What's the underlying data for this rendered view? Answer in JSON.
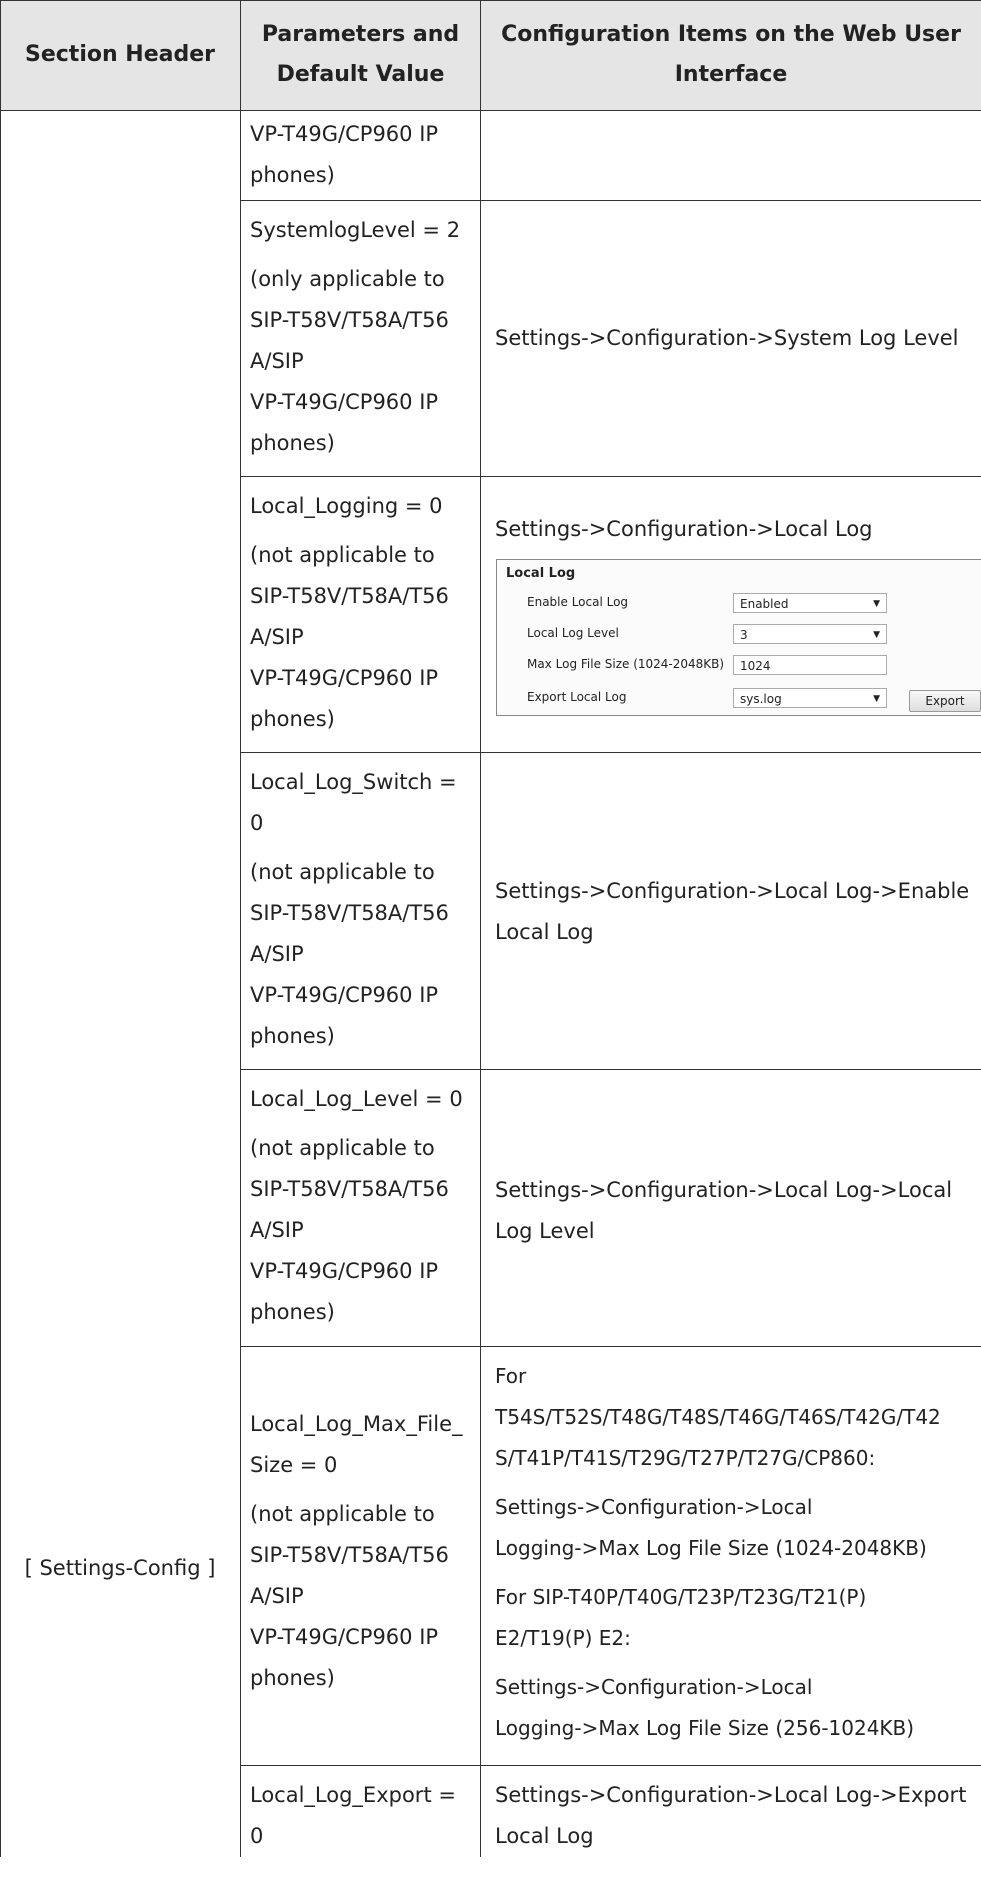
{
  "headers": {
    "section": "Section Header",
    "param": [
      "Parameters and",
      "Default Value"
    ],
    "config": [
      "Configuration Items on the Web User",
      "Interface"
    ]
  },
  "section_value": "[ Settings-Config ]",
  "rows": [
    {
      "param": [
        "VP-T49G/CP960 IP",
        "phones)"
      ],
      "config": []
    },
    {
      "param": [
        "SystemlogLevel = 2",
        "",
        "(only applicable to",
        "SIP-T58V/T58A/T56",
        "A/SIP",
        "VP-T49G/CP960 IP",
        "phones)"
      ],
      "config": [
        "Settings->Configuration->System Log Level"
      ]
    },
    {
      "param": [
        "Local_Logging = 0",
        "",
        "(not applicable to",
        "SIP-T58V/T58A/T56",
        "A/SIP",
        "VP-T49G/CP960 IP",
        "phones)"
      ],
      "config": [
        "Settings->Configuration->Local Log"
      ]
    },
    {
      "param": [
        "Local_Log_Switch =",
        "0",
        "",
        "(not applicable to",
        "SIP-T58V/T58A/T56",
        "A/SIP",
        "VP-T49G/CP960 IP",
        "phones)"
      ],
      "config": [
        "Settings->Configuration->Local Log->Enable",
        "Local Log"
      ]
    },
    {
      "param": [
        "Local_Log_Level = 0",
        "",
        "(not applicable to",
        "SIP-T58V/T58A/T56",
        "A/SIP",
        "VP-T49G/CP960 IP",
        "phones)"
      ],
      "config": [
        "Settings->Configuration->Local Log->Local",
        "Log Level"
      ]
    },
    {
      "param": [
        "Local_Log_Max_File_",
        "Size = 0",
        "",
        "(not applicable to",
        "SIP-T58V/T58A/T56",
        "A/SIP",
        "VP-T49G/CP960 IP",
        "phones)"
      ],
      "config": [
        "For",
        "T54S/T52S/T48G/T48S/T46G/T46S/T42G/T42",
        "S/T41P/T41S/T29G/T27P/T27G/CP860:",
        "",
        "Settings->Configuration->Local",
        "Logging->Max Log File Size (1024-2048KB)",
        "",
        "For SIP-T40P/T40G/T23P/T23G/T21(P)",
        "E2/T19(P) E2:",
        "",
        "Settings->Configuration->Local",
        "Logging->Max Log File Size (256-1024KB)"
      ]
    },
    {
      "param": [
        "Local_Log_Export =",
        "0"
      ],
      "config": [
        "Settings->Configuration->Local Log->Export",
        "Local Log"
      ]
    }
  ],
  "local_log_panel": {
    "title": "Local Log",
    "fields": [
      {
        "label": "Enable Local Log",
        "value": "Enabled",
        "type": "select"
      },
      {
        "label": "Local Log Level",
        "value": "3",
        "type": "select"
      },
      {
        "label": "Max Log File Size (1024-2048KB)",
        "value": "1024",
        "type": "input"
      },
      {
        "label": "Export Local Log",
        "value": "sys.log",
        "type": "select"
      }
    ],
    "export_button": "Export"
  }
}
